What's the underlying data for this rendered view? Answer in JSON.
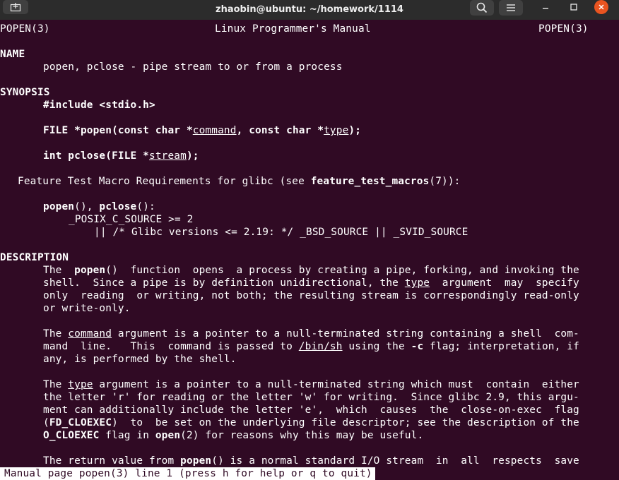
{
  "window": {
    "title": "zhaobin@ubuntu: ~/homework/1114",
    "newtab_icon": "new-tab-icon",
    "search_icon": "search-icon",
    "menu_icon": "hamburger-menu-icon",
    "minimize_icon": "minimize-icon",
    "maximize_icon": "maximize-icon",
    "close_icon": "close-icon",
    "close_color": "#e95420",
    "terminal_bg": "#300a24"
  },
  "terminal": {
    "header_left": "POPEN(3)",
    "header_center": "Linux Programmer's Manual",
    "header_right": "POPEN(3)",
    "name_heading": "NAME",
    "name_text": "popen, pclose - pipe stream to or from a process",
    "synopsis_heading": "SYNOPSIS",
    "include": "#include <stdio.h>",
    "popen_sig": {
      "p1": "FILE *popen(const char *",
      "arg1": "command",
      "p2": ", const char *",
      "arg2": "type",
      "p3": ");"
    },
    "pclose_sig": {
      "p1": "int pclose(FILE *",
      "arg1": "stream",
      "p2": ");"
    },
    "ftm": {
      "p1": "Feature Test Macro Requirements for glibc (see ",
      "macro": "feature_test_macros",
      "p2": "(7)):"
    },
    "ftm_funcs": {
      "f1": "popen",
      "sep": "(), ",
      "f2": "pclose",
      "end": "():"
    },
    "ftm_cond1": "_POSIX_C_SOURCE >= 2",
    "ftm_cond2": "|| /* Glibc versions <= 2.19: */ _BSD_SOURCE || _SVID_SOURCE",
    "description_heading": "DESCRIPTION",
    "d1": {
      "a": "The  ",
      "b": "popen",
      "c": "()  function  opens  a process by creating a pipe, forking, and invoking the"
    },
    "d2": {
      "a": "shell.  Since a pipe is by definition unidirectional, the ",
      "b": "type",
      "c": "  argument  may  specify"
    },
    "d3": "only  reading  or writing, not both; the resulting stream is correspondingly read-only",
    "d4": "or write-only.",
    "d5": {
      "a": "The ",
      "b": "command",
      "c": " argument is a pointer to a null-terminated string containing a shell  com‐"
    },
    "d6": {
      "a": "mand  line.   This  command is passed to ",
      "b": "/bin/sh",
      "c": " using the ",
      "d": "-c",
      "e": " flag; interpretation, if"
    },
    "d7": "any, is performed by the shell.",
    "d8": {
      "a": "The ",
      "b": "type",
      "c": " argument is a pointer to a null-terminated string which must  contain  either"
    },
    "d9": "the letter 'r' for reading or the letter 'w' for writing.  Since glibc 2.9, this argu‐",
    "d10": "ment can additionally include the letter 'e',  which  causes  the  close-on-exec  flag",
    "d11": {
      "a": "(",
      "b": "FD_CLOEXEC",
      "c": ")  to  be set on the underlying file descriptor; see the description of the"
    },
    "d12": {
      "a": "O_CLOEXEC",
      "b": " flag in ",
      "c": "open",
      "d": "(2) for reasons why this may be useful."
    },
    "d13": {
      "a": "The return value from ",
      "b": "popen",
      "c": "() is a normal standard I/O stream  in  all  respects  save"
    }
  },
  "status_bar": "Manual page popen(3) line 1 (press h for help or q to quit)"
}
